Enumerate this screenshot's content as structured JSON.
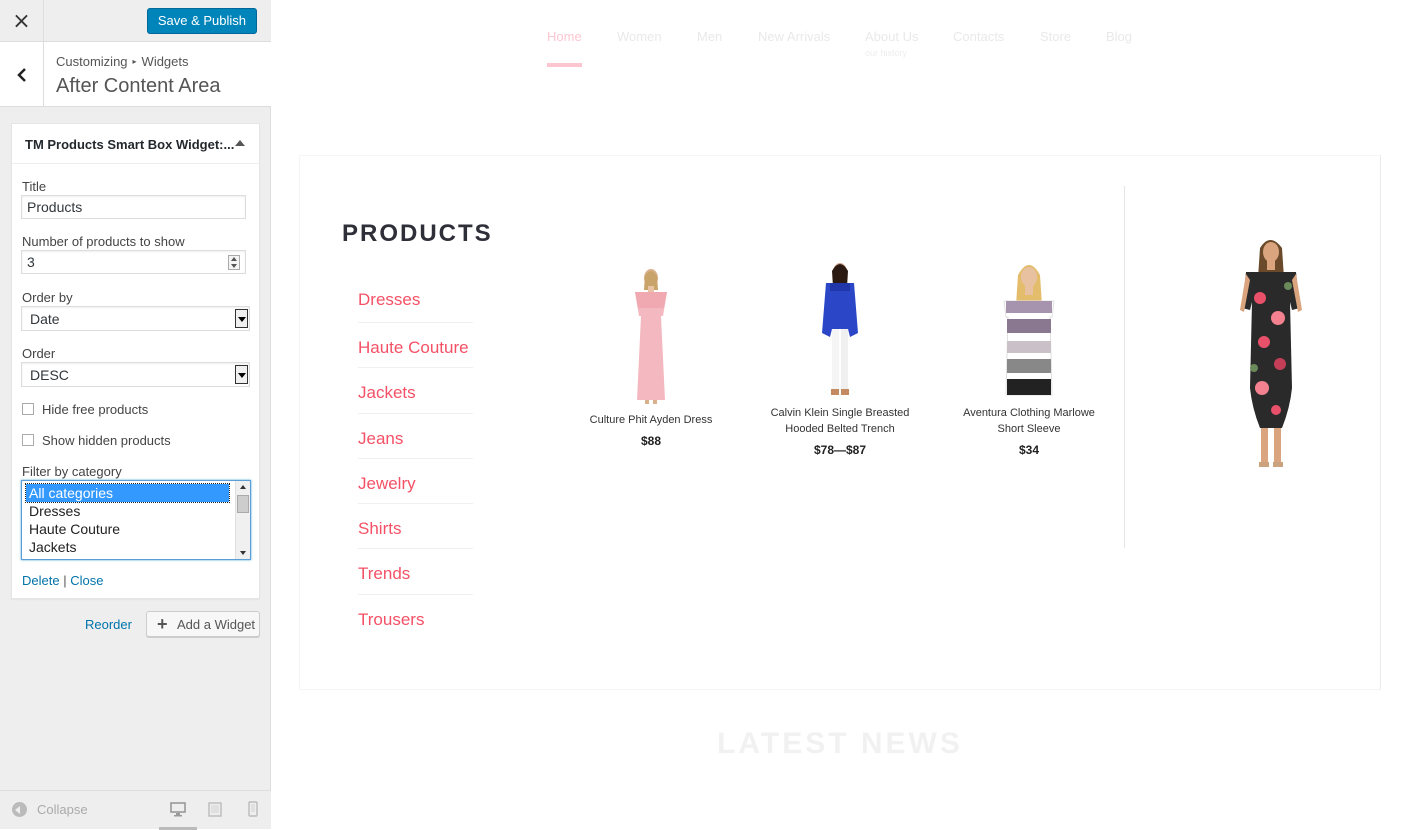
{
  "header": {
    "close_symbol": "×",
    "publish_label": "Save & Publish"
  },
  "section": {
    "crumb_root": "Customizing",
    "crumb_sep": "▸",
    "crumb_leaf": "Widgets",
    "title": "After Content Area"
  },
  "widget": {
    "title": "TM Products Smart Box Widget:...",
    "fields": {
      "title_label": "Title",
      "title_value": "Products",
      "count_label": "Number of products to show",
      "count_value": "3",
      "orderby_label": "Order by",
      "orderby_value": "Date",
      "order_label": "Order",
      "order_value": "DESC",
      "hide_free_label": "Hide free products",
      "show_hidden_label": "Show hidden products",
      "filter_label": "Filter by category",
      "filter_options": [
        "All categories",
        "Dresses",
        "Haute Couture",
        "Jackets"
      ]
    },
    "delete_label": "Delete",
    "actions_sep": "|",
    "close_label": "Close"
  },
  "panel_actions": {
    "reorder_label": "Reorder",
    "add_widget_label": "Add a Widget"
  },
  "footer": {
    "collapse_label": "Collapse"
  },
  "preview": {
    "nav": [
      {
        "label": "Home",
        "sub": ""
      },
      {
        "label": "Women",
        "sub": ""
      },
      {
        "label": "Men",
        "sub": ""
      },
      {
        "label": "New Arrivals",
        "sub": ""
      },
      {
        "label": "About Us",
        "sub": "our history"
      },
      {
        "label": "Contacts",
        "sub": ""
      },
      {
        "label": "Store",
        "sub": ""
      },
      {
        "label": "Blog",
        "sub": ""
      }
    ],
    "products_title": "PRODUCTS",
    "categories": [
      "Dresses",
      "Haute Couture",
      "Jackets",
      "Jeans",
      "Jewelry",
      "Shirts",
      "Trends",
      "Trousers"
    ],
    "products": [
      {
        "name": "Culture Phit Ayden Dress",
        "price": "$88"
      },
      {
        "name": "Calvin Klein Single Breasted Hooded Belted Trench",
        "price": "$78—$87"
      },
      {
        "name": "Aventura Clothing Marlowe Short Sleeve",
        "price": "$34"
      }
    ],
    "news_title": "LATEST NEWS"
  },
  "colors": {
    "accent": "#0085ba",
    "category_link": "#f45166",
    "nav_active": "#fcc7d0"
  }
}
